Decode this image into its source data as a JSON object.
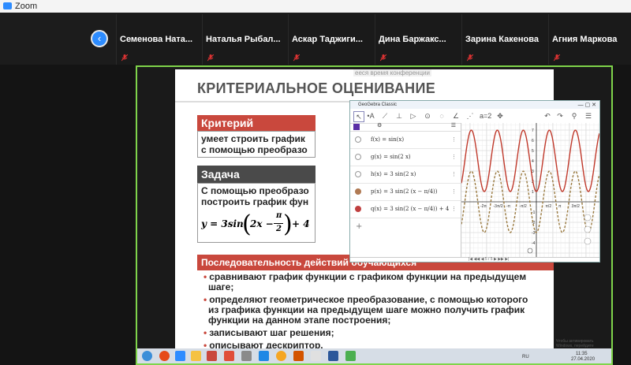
{
  "app": {
    "title": "Zoom"
  },
  "participants": [
    {
      "name": "Семенова  Ната..."
    },
    {
      "name": "Наталья  Рыбал..."
    },
    {
      "name": "Аскар  Таджиги..."
    },
    {
      "name": "Дина  Баржакс..."
    },
    {
      "name": "Зарина Какенова"
    },
    {
      "name": "Агния Маркова"
    }
  ],
  "share_label": "ееся время конференции",
  "slide": {
    "title": "КРИТЕРИАЛЬНОЕ ОЦЕНИВАНИЕ",
    "criterion": {
      "header": "Критерий",
      "lines": [
        "умеет строить график",
        "с помощью преобразо"
      ]
    },
    "task": {
      "header": "Задача",
      "lines": [
        "С помощью преобразо",
        "построить график фун"
      ],
      "formula": {
        "y": "y = 3sin",
        "inner": "2x −",
        "num": "π",
        "den": "2",
        "tail": "+ 4"
      }
    },
    "sequence": {
      "header": "Последовательность действий обучающихся",
      "bullets": [
        [
          "сравнивают график функции с графиком функции на предыдущем",
          "шаге;"
        ],
        [
          "определяют геометрическое преобразование, с помощью которого",
          "из графика функции на предыдущем шаге можно получить график",
          "функции на данном этапе построения;"
        ],
        [
          "записывают шаг решения;"
        ],
        [
          "описывают дескриптор."
        ]
      ]
    }
  },
  "geogebra": {
    "window_title": "GeoGebra Classic",
    "window_controls": "— ▢ ✕",
    "algebra": [
      {
        "expr": "f(x) = sin(x)",
        "color": "#ffffff"
      },
      {
        "expr": "g(x) = sin(2 x)",
        "color": "#ffffff"
      },
      {
        "expr": "h(x) = 3 sin(2 x)",
        "color": "#ffffff"
      },
      {
        "expr": "p(x) = 3 sin(2 (x − π/4))",
        "color": "#b07a53"
      },
      {
        "expr": "q(x) = 3 sin(2 (x − π/4)) + 4",
        "color": "#c04040"
      }
    ],
    "input_plus": "+",
    "status_nav": "|◀ ◀◀ ◀  5 / 5  ▶ ▶▶ ▶|",
    "graph": {
      "x_ticks": [
        "-2π",
        "-3π/2",
        "-π",
        "-π/2",
        "π/2",
        "π",
        "3π/2"
      ],
      "y_ticks": [
        "7",
        "6",
        "5",
        "4",
        "3",
        "2",
        "1",
        "-1",
        "-2",
        "-3",
        "-4"
      ],
      "colors": {
        "q": "#c0392b",
        "p": "#9a7a40"
      }
    }
  },
  "tray": {
    "lang": "RU",
    "time": "11:35",
    "date": "27.04.2020",
    "note": "Чтобы активировать Windows, перейдите"
  },
  "colors": {
    "accent": "#2d8cff",
    "active_border": "#7fd44b",
    "slide_red": "#c9483d"
  }
}
